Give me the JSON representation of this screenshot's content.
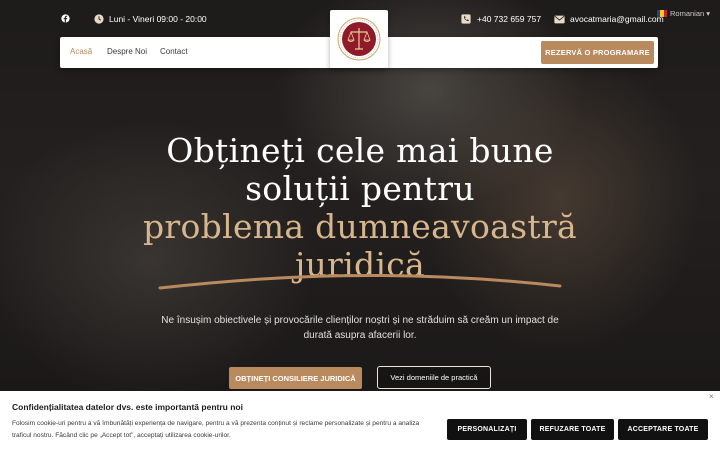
{
  "topbar": {
    "hours": "Luni - Vineri 09:00 - 20:00",
    "phone": "+40 732 659 757",
    "email": "avocatmaria@gmail.com",
    "language": "Romanian",
    "language_arrow": "▾"
  },
  "nav": {
    "links": [
      "Acasă",
      "Despre Noi",
      "Contact"
    ],
    "cta": "REZERVĂ O PROGRAMARE"
  },
  "hero": {
    "line1": "Obțineți cele mai bune",
    "line2": "soluții pentru",
    "line3": "problema dumneavoastră",
    "line4": "juridică",
    "subtitle": "Ne însușim obiectivele și provocările clienților noștri și ne străduim să creăm un impact de durată asupra afacerii lor.",
    "primary_button": "OBȚINEȚI CONSILIERE JURIDICĂ",
    "secondary_button": "Vezi domeniile de practică"
  },
  "cookie": {
    "title": "Confidențialitatea datelor dvs. este importantă pentru noi",
    "text": "Folosim cookie-uri pentru a vă îmbunătăți experiența de navigare, pentru a vă prezenta conținut și reclame personalizate și pentru a analiza traficul nostru. Făcând clic pe „Accept tot”, acceptați utilizarea cookie-urilor.",
    "close": "×",
    "buttons": [
      "PERSONALIZAȚI",
      "REFUZARE TOATE",
      "ACCEPTARE TOATE"
    ]
  },
  "colors": {
    "accent": "#b88a5e",
    "headline_gold": "#d7b68e",
    "logo_red": "#8e1a2a",
    "cookie_button": "#111111"
  },
  "icons": [
    "facebook-icon",
    "clock-icon",
    "phone-icon",
    "email-icon",
    "flag-icon",
    "scales-logo-icon",
    "close-icon"
  ]
}
